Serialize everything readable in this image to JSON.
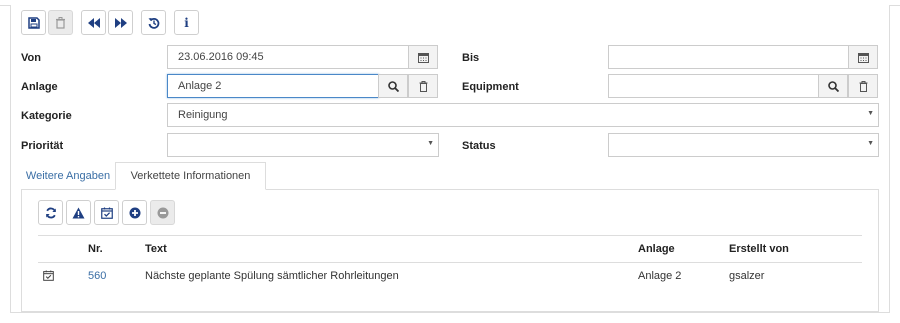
{
  "fields": {
    "von": {
      "label": "Von",
      "value": "23.06.2016 09:45"
    },
    "bis": {
      "label": "Bis",
      "value": ""
    },
    "anlage": {
      "label": "Anlage",
      "value": "Anlage 2"
    },
    "equipment": {
      "label": "Equipment",
      "value": ""
    },
    "kategorie": {
      "label": "Kategorie",
      "value": "Reinigung"
    },
    "prioritaet": {
      "label": "Priorität",
      "value": ""
    },
    "status": {
      "label": "Status",
      "value": ""
    }
  },
  "info_button_label": "i",
  "tabs": [
    {
      "label": "Weitere Angaben",
      "active": false
    },
    {
      "label": "Verkettete Informationen",
      "active": true
    }
  ],
  "table": {
    "columns": [
      "Nr.",
      "Text",
      "Anlage",
      "Erstellt von"
    ],
    "rows": [
      {
        "nr": "560",
        "text": "Nächste geplante Spülung sämtlicher Rohrleitungen",
        "anlage": "Anlage 2",
        "erstellt_von": "gsalzer"
      }
    ]
  },
  "colors": {
    "accent": "#1f3f82",
    "link": "#3a6ea5",
    "border": "#dddddd"
  }
}
